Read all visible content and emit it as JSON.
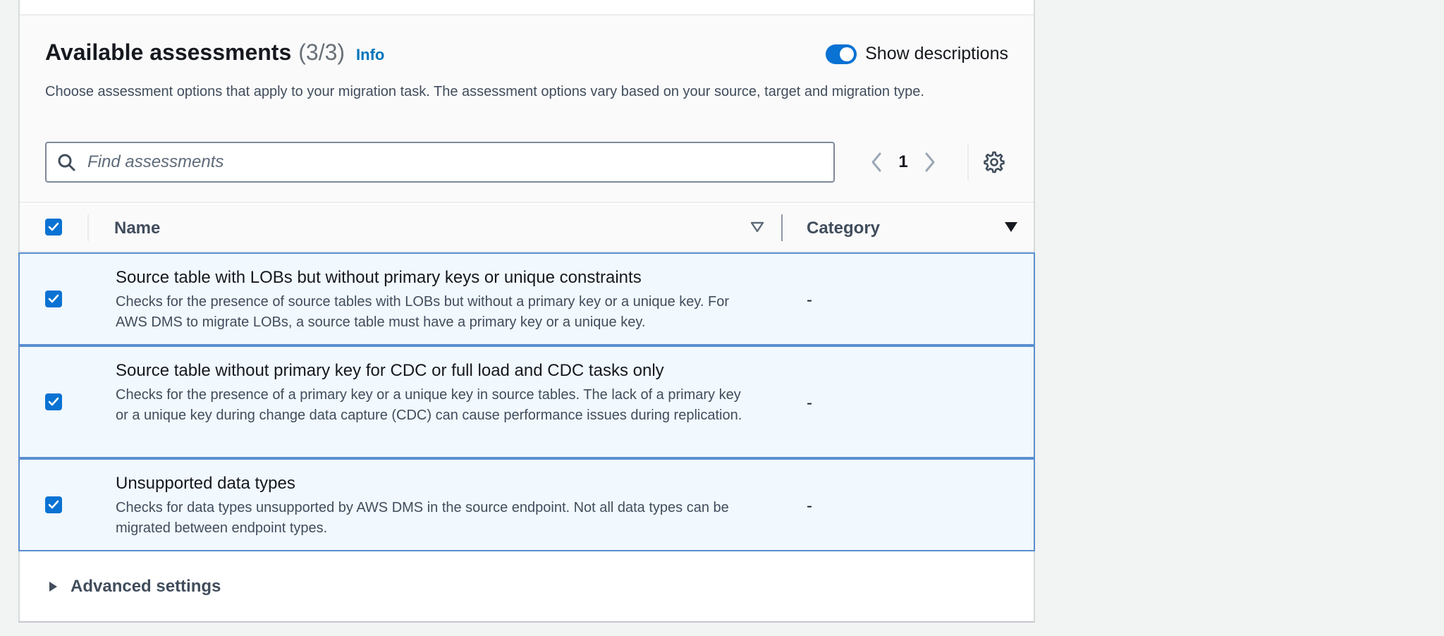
{
  "header": {
    "title": "Available assessments",
    "count": "(3/3)",
    "info_link": "Info",
    "toggle_label": "Show descriptions",
    "toggle_on": true,
    "description": "Choose assessment options that apply to your migration task. The assessment options vary based on your source, target and migration type."
  },
  "search": {
    "placeholder": "Find assessments",
    "value": ""
  },
  "pagination": {
    "current_page": "1"
  },
  "table": {
    "columns": [
      "Name",
      "Category"
    ],
    "rows": [
      {
        "selected": true,
        "name": "Source table with LOBs but without primary keys or unique constraints",
        "description": "Checks for the presence of source tables with LOBs but without a primary key or a unique key. For AWS DMS to migrate LOBs, a source table must have a primary key or a unique key.",
        "category": "-"
      },
      {
        "selected": true,
        "name": "Source table without primary key for CDC or full load and CDC tasks only",
        "description": "Checks for the presence of a primary key or a unique key in source tables. The lack of a primary key or a unique key during change data capture (CDC) can cause performance issues during replication.",
        "category": "-"
      },
      {
        "selected": true,
        "name": "Unsupported data types",
        "description": "Checks for data types unsupported by AWS DMS in the source endpoint. Not all data types can be migrated between endpoint types.",
        "category": "-"
      }
    ]
  },
  "advanced": {
    "label": "Advanced settings"
  },
  "colors": {
    "accent": "#0972d3",
    "link": "#0073bb",
    "selected_row_bg": "#f1f8fe",
    "selected_row_border": "#5a8fd0"
  }
}
